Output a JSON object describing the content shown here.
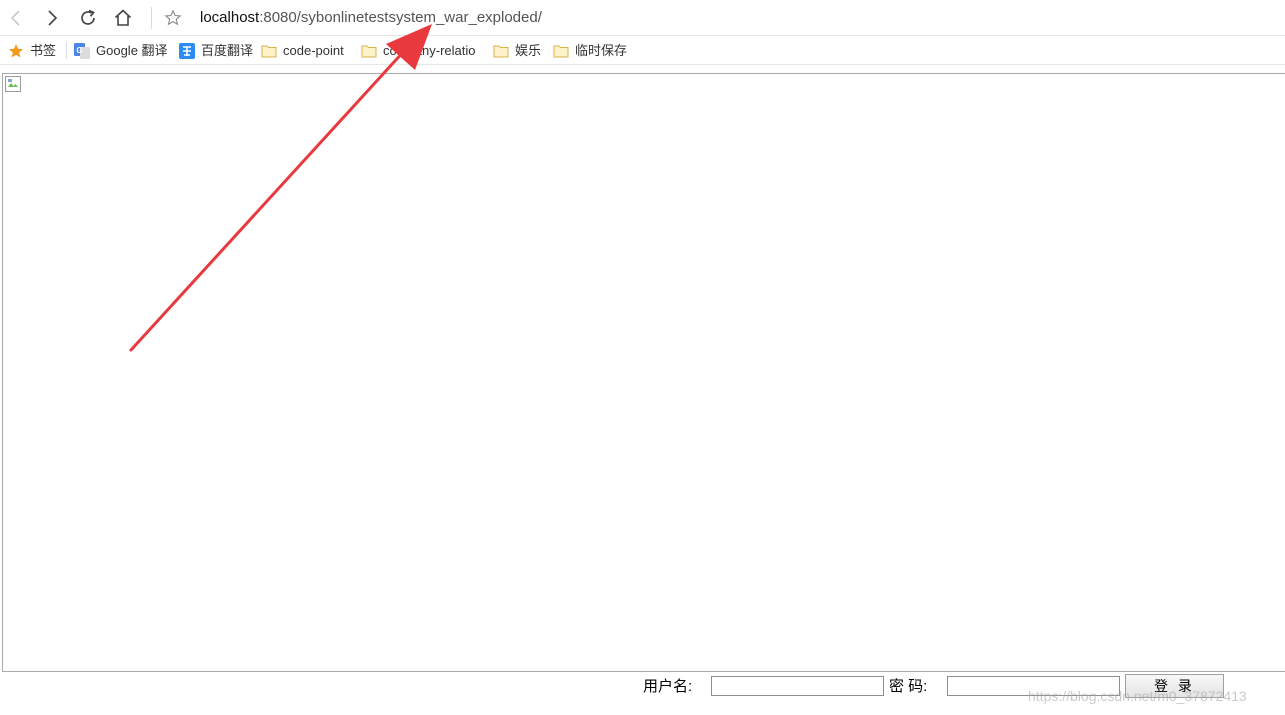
{
  "address_bar": {
    "url_host": "localhost",
    "url_path": ":8080/sybonlinetestsystem_war_exploded/"
  },
  "bookmarks": {
    "items": [
      {
        "label": "书签",
        "icon": "star-icon"
      },
      {
        "label": "Google 翻译",
        "icon": "google-translate-icon"
      },
      {
        "label": "百度翻译",
        "icon": "baidu-translate-icon"
      },
      {
        "label": "code-point",
        "icon": "folder-icon"
      },
      {
        "label": "company-relatio",
        "icon": "folder-icon"
      },
      {
        "label": "娱乐",
        "icon": "folder-icon"
      },
      {
        "label": "临时保存",
        "icon": "folder-icon"
      }
    ]
  },
  "login": {
    "username_label": "用户名:",
    "username_value": "",
    "password_label": "密 码:",
    "password_value": "",
    "submit_label": "登 录"
  },
  "watermark": "https://blog.csdn.net/m0_37872413",
  "colors": {
    "annotation_arrow": "#e8393f",
    "star": "#f39a1e",
    "folder": "#f2c94c",
    "baidu_blue": "#2d8cf0"
  }
}
